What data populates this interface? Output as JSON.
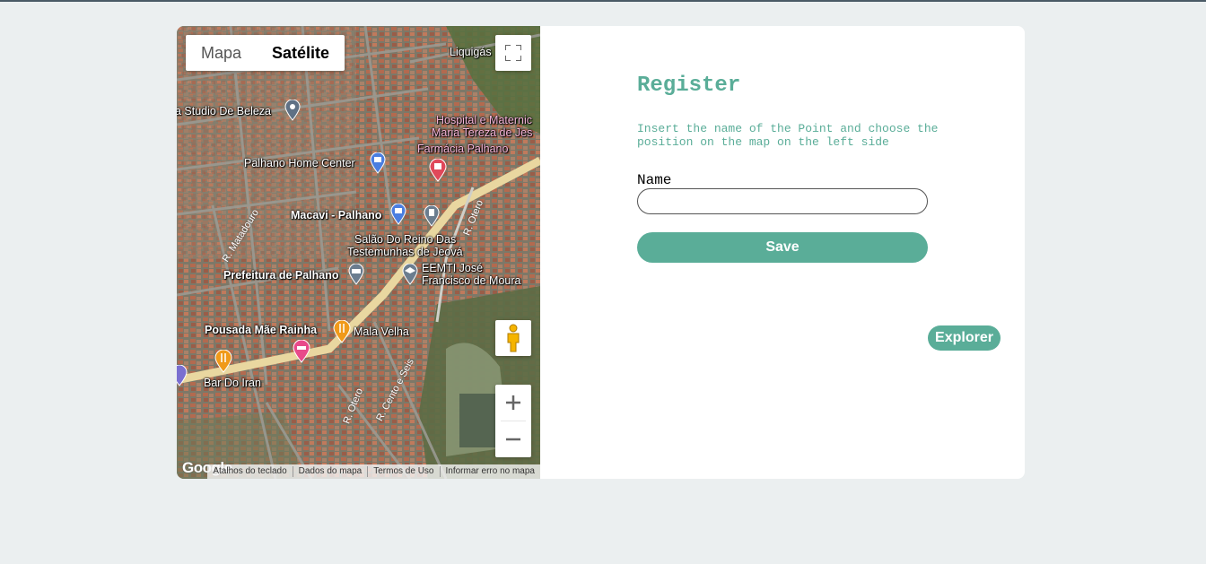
{
  "map": {
    "type_buttons": [
      "Mapa",
      "Satélite"
    ],
    "selected_type": "Satélite",
    "places": {
      "studio": "a Studio De Beleza",
      "home_center": "Palhano Home Center",
      "macavi": "Macavi - Palhano",
      "hospital1": "Hospital e Maternic",
      "hospital2": "Maria Tereza de Jes",
      "farmacia": "Farmácia Palhano",
      "salao1": "Salão Do Reino Das",
      "salao2": "Testemunhas de Jeová",
      "prefeitura": "Prefeitura de Palhano",
      "eemti1": "EEMTI José",
      "eemti2": "Francisco de Moura",
      "pousada": "Pousada Mãe Rainha",
      "mala": "Mala Velha",
      "bar": "Bar Do Iran",
      "liquigas": "Liquigás"
    },
    "streets": {
      "matadouro": "R. Matadouro",
      "otero1": "R. Otero",
      "otero2": "R. Otero",
      "cento": "R. Cento e Seis"
    },
    "google_logo": "Google",
    "footer_links": [
      "Atalhos do teclado",
      "Dados do mapa",
      "Termos de Uso",
      "Informar erro no mapa"
    ],
    "controls": {
      "fullscreen_icon": "fullscreen-icon",
      "pegman_icon": "pegman-icon",
      "zoom_in_icon": "plus-icon",
      "zoom_out_icon": "minus-icon"
    }
  },
  "form": {
    "title": "Register",
    "subtitle": "Insert the name of the Point and choose the position on the map on the left side",
    "name_label": "Name",
    "name_value": "",
    "save_label": "Save",
    "explorer_label": "Explorer"
  },
  "colors": {
    "accent": "#5aad98",
    "background": "#ebeff0",
    "card": "#ffffff"
  }
}
